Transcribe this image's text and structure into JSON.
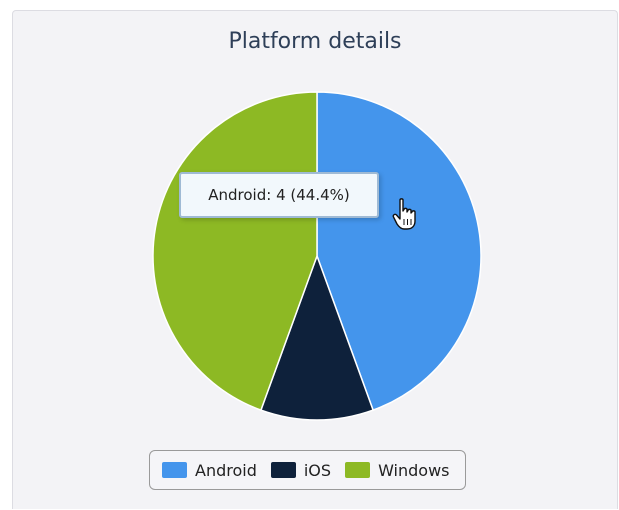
{
  "chart_data": {
    "type": "pie",
    "title": "Platform details",
    "categories": [
      "Android",
      "iOS",
      "Windows"
    ],
    "values": [
      4,
      1,
      4
    ],
    "colors": [
      "#4495ec",
      "#0e213b",
      "#8db924"
    ],
    "legend_position": "bottom",
    "tooltip": {
      "label": "Android",
      "value": 4,
      "percent": "44.4%",
      "text": "Android: 4 (44.4%)"
    }
  },
  "cursor": {
    "icon": "hand-pointer-icon"
  }
}
